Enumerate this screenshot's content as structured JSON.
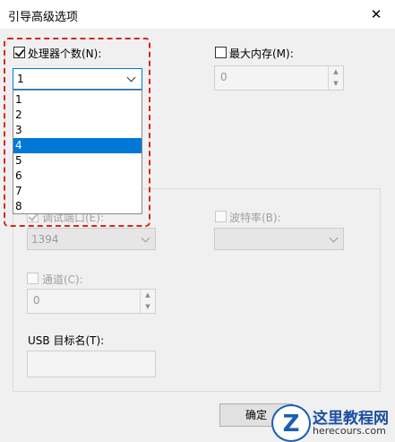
{
  "window": {
    "title": "引导高级选项",
    "close_glyph": "✕"
  },
  "processor": {
    "label": "处理器个数(N):",
    "checked": true,
    "selected": "1",
    "options": [
      "1",
      "2",
      "3",
      "4",
      "5",
      "6",
      "7",
      "8"
    ],
    "highlighted_index": 3
  },
  "max_memory": {
    "label": "最大内存(M):",
    "value": "0",
    "checked": false
  },
  "debug": {
    "port_label": "调试端口(E):",
    "port_value": "1394",
    "baud_label": "波特率(B):",
    "baud_value": "",
    "channel_label": "通道(C):",
    "channel_value": "0",
    "usb_label": "USB 目标名(T):",
    "usb_value": ""
  },
  "buttons": {
    "ok_label": "确定"
  },
  "watermark": {
    "logo": "Z",
    "text": "这里教程网",
    "url": "herecours.com"
  },
  "colors": {
    "accent": "#0078d7",
    "highlight_border": "#d9261c"
  }
}
